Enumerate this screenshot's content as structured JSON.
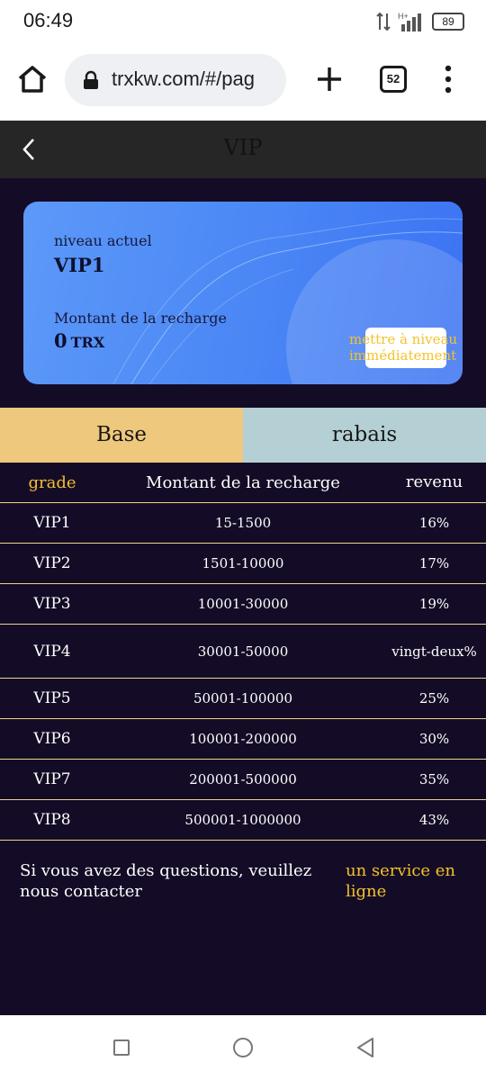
{
  "status_bar": {
    "time": "06:49",
    "battery": "89",
    "network": "H+"
  },
  "browser": {
    "url": "trxkw.com/#/pag",
    "tab_count": "52"
  },
  "header": {
    "title": "VIP"
  },
  "card": {
    "level_label": "niveau actuel",
    "level_value": "VIP1",
    "recharge_label": "Montant de la recharge",
    "recharge_amount": "0",
    "recharge_unit": "TRX",
    "upgrade_label": "mettre à niveau immédiatement"
  },
  "tabs": [
    {
      "label": "Base",
      "active": true,
      "color": "#eec87c"
    },
    {
      "label": "rabais",
      "active": false,
      "color": "#b5d0d4"
    }
  ],
  "table": {
    "headers": {
      "grade": "grade",
      "amount": "Montant de la recharge",
      "revenue": "revenu"
    },
    "rows": [
      {
        "grade": "VIP1",
        "amount": "15-1500",
        "revenue": "16%"
      },
      {
        "grade": "VIP2",
        "amount": "1501-10000",
        "revenue": "17%"
      },
      {
        "grade": "VIP3",
        "amount": "10001-30000",
        "revenue": "19%"
      },
      {
        "grade": "VIP4",
        "amount": "30001-50000",
        "revenue": "vingt-deux%"
      },
      {
        "grade": "VIP5",
        "amount": "50001-100000",
        "revenue": "25%"
      },
      {
        "grade": "VIP6",
        "amount": "100001-200000",
        "revenue": "30%"
      },
      {
        "grade": "VIP7",
        "amount": "200001-500000",
        "revenue": "35%"
      },
      {
        "grade": "VIP8",
        "amount": "500001-1000000",
        "revenue": "43%"
      }
    ]
  },
  "footer": {
    "contact_text": "Si vous avez des questions, veuillez nous contacter",
    "contact_link": "un service en ligne"
  },
  "colors": {
    "page_bg": "#140c26",
    "accent_gold": "#f4c22b",
    "card_blue": "#4a86f5",
    "row_divider": "#e9d28f"
  },
  "icons": [
    "home-icon",
    "lock-icon",
    "plus-icon",
    "tabs-icon",
    "menu-icon",
    "back-icon"
  ]
}
